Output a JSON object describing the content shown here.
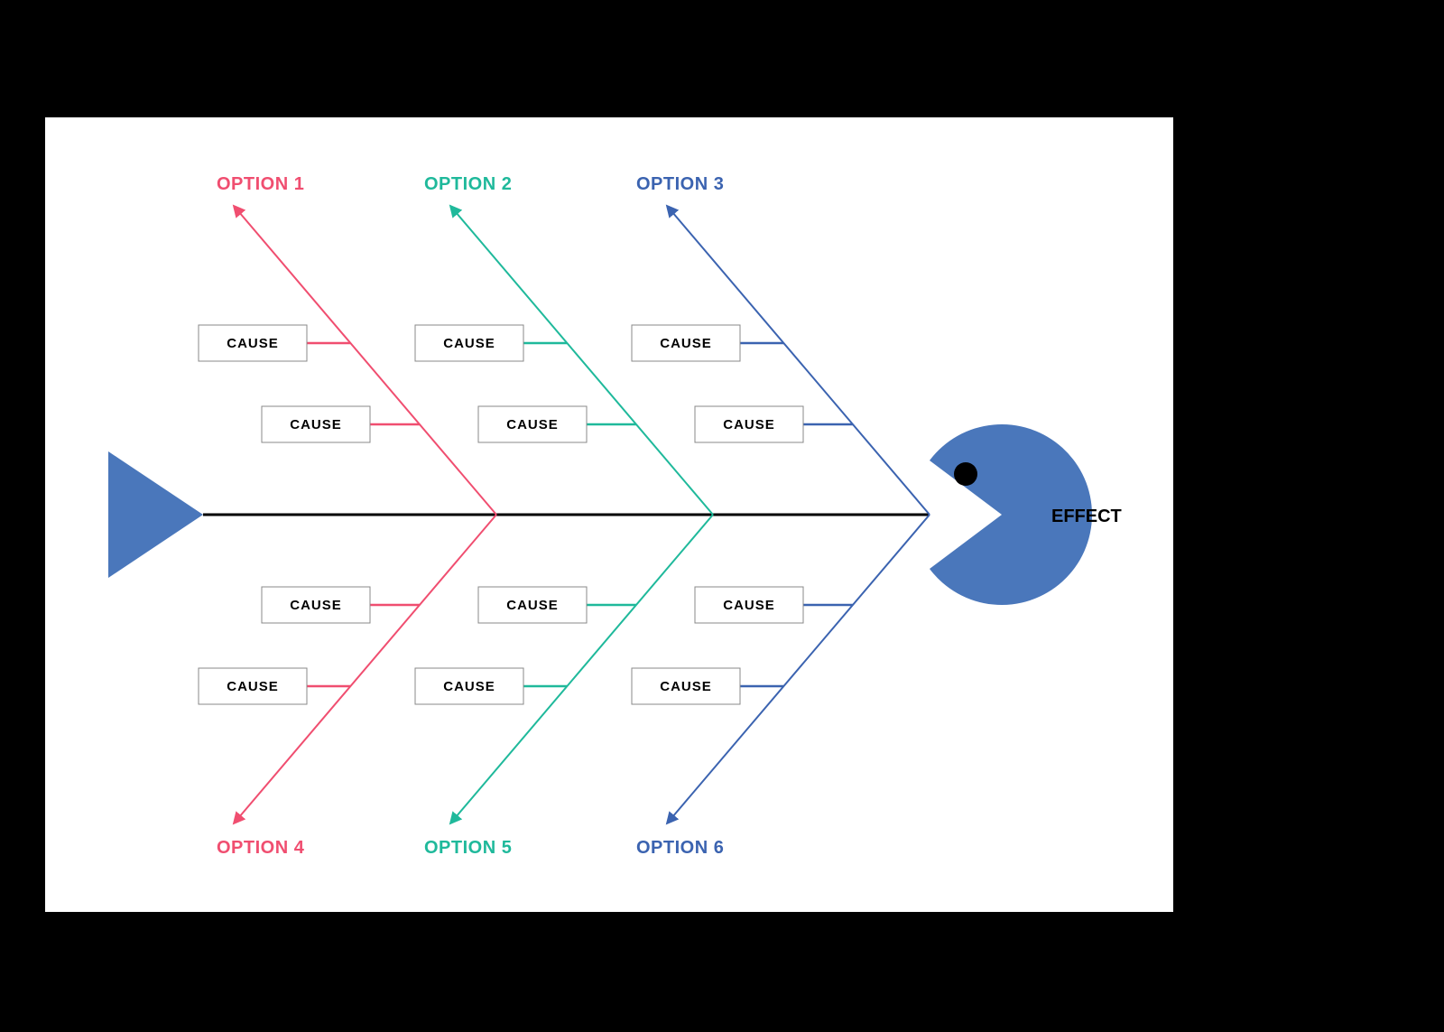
{
  "diagram": {
    "type": "fishbone",
    "effect_label": "EFFECT",
    "cause_label": "CAUSE",
    "colors": {
      "pink": "#f04e70",
      "teal": "#1fb99b",
      "blue": "#3b63b0",
      "fish": "#4a77bb",
      "spine": "#000000"
    },
    "options_top": [
      "OPTION 1",
      "OPTION 2",
      "OPTION 3"
    ],
    "options_bottom": [
      "OPTION 4",
      "OPTION 5",
      "OPTION 6"
    ]
  }
}
